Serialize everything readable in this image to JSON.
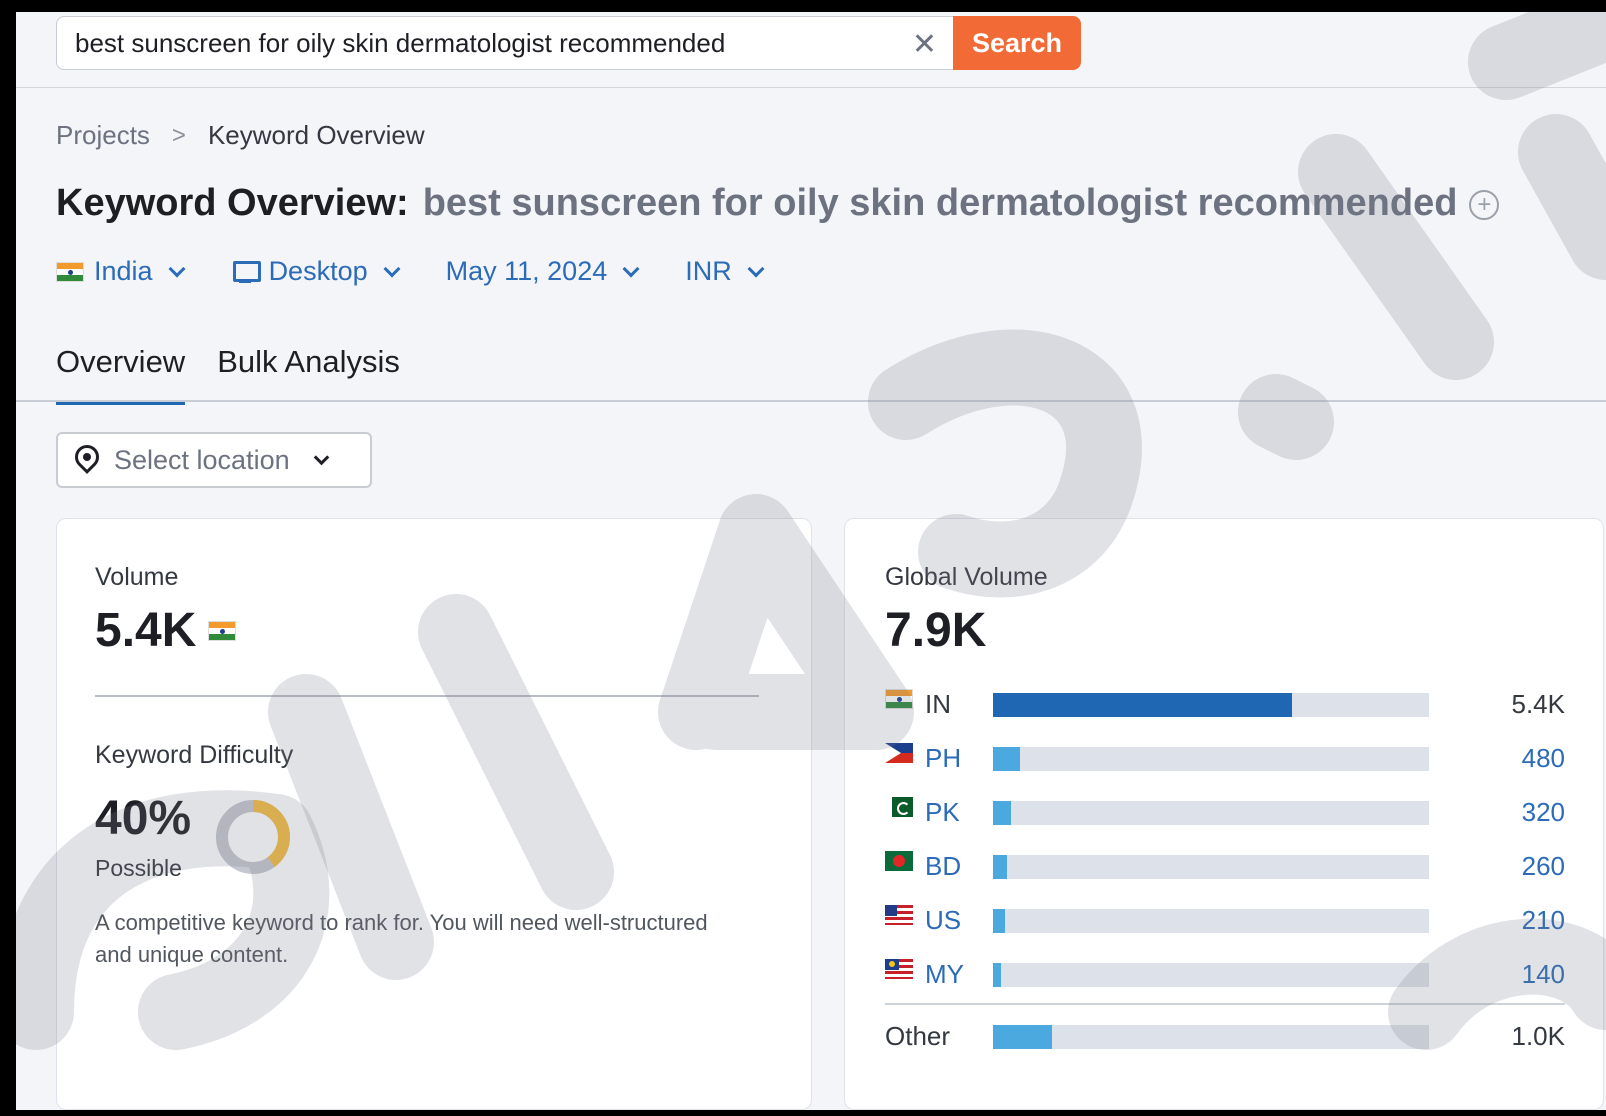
{
  "search": {
    "value": "best sunscreen for oily skin dermatologist recommended",
    "clear_glyph": "✕",
    "button_label": "Search"
  },
  "breadcrumb": {
    "items": [
      "Projects",
      "Keyword Overview"
    ],
    "separator": ">"
  },
  "title": {
    "prefix": "Keyword Overview:",
    "keyword": "best sunscreen for oily skin dermatologist recommended",
    "add_icon": "plus-circle-icon"
  },
  "filters": {
    "country": "India",
    "device": "Desktop",
    "date": "May 11, 2024",
    "currency": "INR"
  },
  "tabs": [
    {
      "label": "Overview",
      "active": true
    },
    {
      "label": "Bulk Analysis",
      "active": false
    }
  ],
  "location": {
    "placeholder": "Select location",
    "icon": "map-pin-icon"
  },
  "volume": {
    "label": "Volume",
    "value": "5.4K",
    "flag": "india-flag-icon"
  },
  "difficulty": {
    "label": "Keyword Difficulty",
    "value": "40%",
    "level": "Possible",
    "percent": 40,
    "color": "#f5bd41",
    "description": "A competitive keyword to rank for. You will need well-structured and unique content."
  },
  "global_volume": {
    "label": "Global Volume",
    "value": "7.9K",
    "countries": [
      {
        "code": "IN",
        "value": "5.4K",
        "fraction": 0.685,
        "flag": "flag-in"
      },
      {
        "code": "PH",
        "value": "480",
        "fraction": 0.061,
        "flag": "flag-ph"
      },
      {
        "code": "PK",
        "value": "320",
        "fraction": 0.041,
        "flag": "flag-pk"
      },
      {
        "code": "BD",
        "value": "260",
        "fraction": 0.033,
        "flag": "flag-bd"
      },
      {
        "code": "US",
        "value": "210",
        "fraction": 0.027,
        "flag": "flag-us"
      },
      {
        "code": "MY",
        "value": "140",
        "fraction": 0.018,
        "flag": "flag-my"
      }
    ],
    "other": {
      "label": "Other",
      "value": "1.0K",
      "fraction": 0.135
    }
  },
  "colors": {
    "accent": "#f26b36",
    "link": "#2b6bb8",
    "bar_primary": "#1f67b2",
    "bar_secondary": "#4ba9df"
  }
}
